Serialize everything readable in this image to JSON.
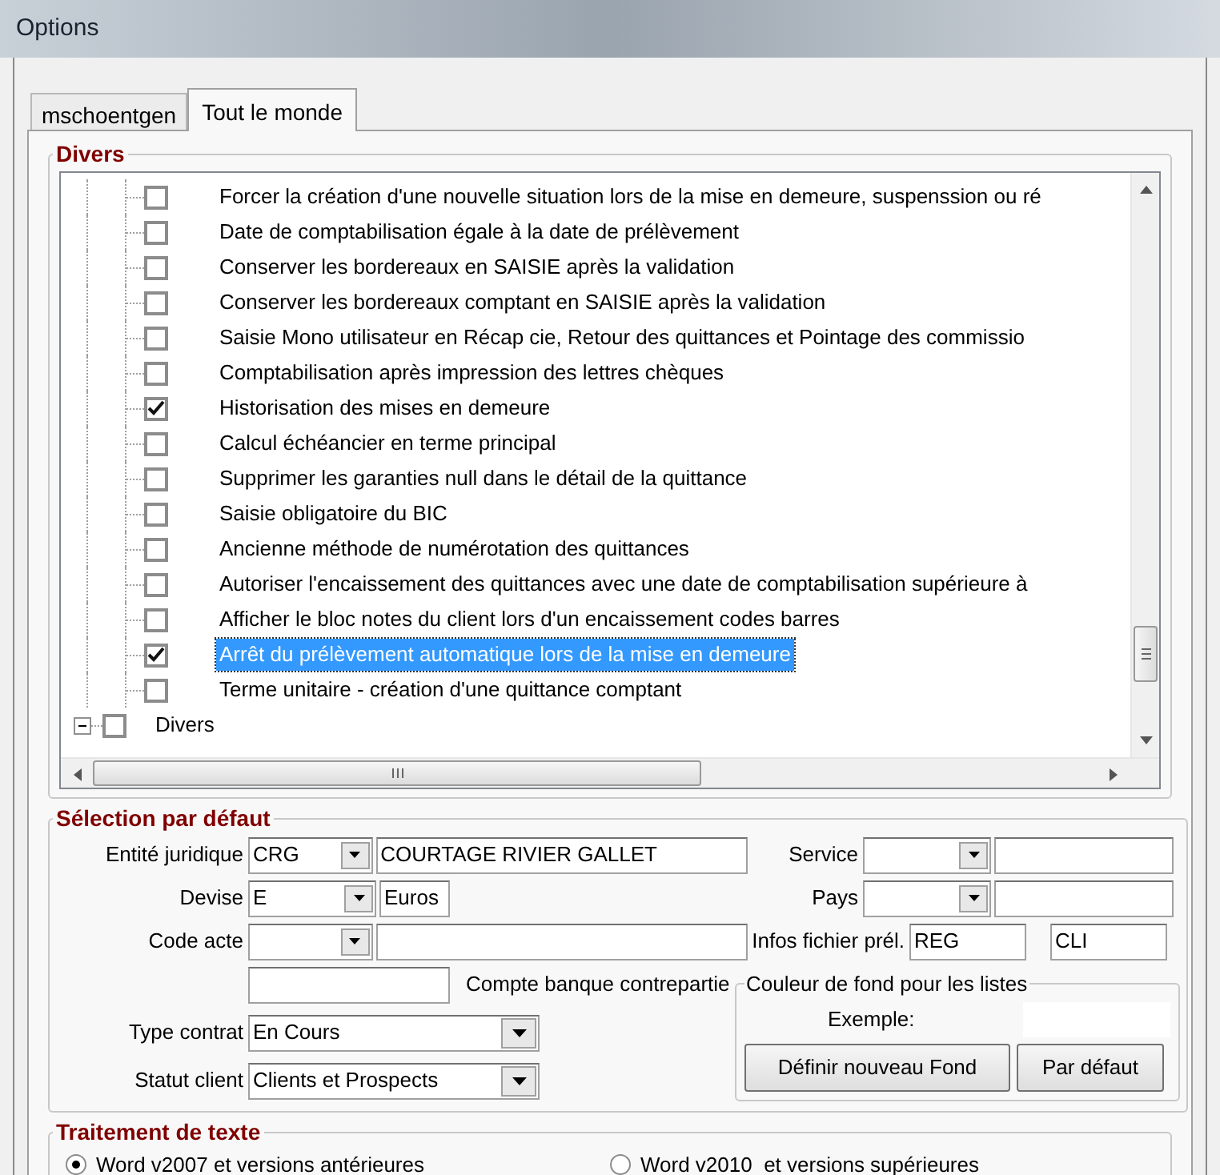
{
  "window": {
    "title": "Options"
  },
  "tabs": [
    {
      "label": "mschoentgen",
      "selected": false
    },
    {
      "label": "Tout le monde",
      "selected": true
    }
  ],
  "divers": {
    "title": "Divers",
    "tree": [
      {
        "children": [
          {
            "label": "Forcer la création d'une nouvelle situation lors de la mise en demeure, suspenssion ou ré",
            "checked": false,
            "selected": false
          },
          {
            "label": "Date de comptabilisation égale à la date de prélèvement",
            "checked": false,
            "selected": false
          },
          {
            "label": "Conserver les bordereaux en SAISIE après la validation",
            "checked": false,
            "selected": false
          },
          {
            "label": "Conserver les bordereaux comptant en SAISIE après la validation",
            "checked": false,
            "selected": false
          },
          {
            "label": "Saisie Mono utilisateur en Récap cie, Retour des quittances et Pointage des commissio",
            "checked": false,
            "selected": false
          },
          {
            "label": "Comptabilisation après impression des lettres chèques",
            "checked": false,
            "selected": false
          },
          {
            "label": "Historisation des mises en demeure",
            "checked": true,
            "selected": false
          },
          {
            "label": "Calcul échéancier en terme principal",
            "checked": false,
            "selected": false
          },
          {
            "label": "Supprimer les garanties null dans le détail de la quittance",
            "checked": false,
            "selected": false
          },
          {
            "label": "Saisie obligatoire du BIC",
            "checked": false,
            "selected": false
          },
          {
            "label": "Ancienne méthode de numérotation des quittances",
            "checked": false,
            "selected": false
          },
          {
            "label": "Autoriser l'encaissement des quittances avec une date de comptabilisation supérieure à",
            "checked": false,
            "selected": false
          },
          {
            "label": "Afficher le bloc notes du client lors d'un encaissement codes barres",
            "checked": false,
            "selected": false
          },
          {
            "label": "Arrêt du prélèvement automatique lors de la mise en demeure",
            "checked": true,
            "selected": true
          },
          {
            "label": "Terme unitaire - création d'une quittance comptant",
            "checked": false,
            "selected": false
          }
        ]
      },
      {
        "label": "Divers",
        "checked": false,
        "expanded": true,
        "selected": false
      }
    ]
  },
  "selection": {
    "title": "Sélection par défaut",
    "left": [
      {
        "kind": "combo_text",
        "label": "Entité juridique",
        "code": "CRG",
        "value": "COURTAGE RIVIER GALLET"
      },
      {
        "kind": "combo_short",
        "label": "Devise",
        "code": "E",
        "value": "Euros"
      },
      {
        "kind": "combo_text",
        "label": "Code acte"
      },
      {
        "kind": "text_after",
        "after": "Compte banque contrepartie"
      },
      {
        "kind": "dropdown",
        "label": "Type contrat",
        "value": "En Cours"
      },
      {
        "kind": "dropdown",
        "label": "Statut client",
        "value": "Clients et Prospects"
      }
    ],
    "right": [
      {
        "kind": "combo_text",
        "label": "Service"
      },
      {
        "kind": "combo_text",
        "label": "Pays"
      },
      {
        "kind": "two_text",
        "label": "Infos fichier prél.",
        "value": "REG",
        "value2": "CLI"
      }
    ],
    "color_group": {
      "title": "Couleur de fond pour les listes",
      "example_label": "Exemple:",
      "buttons": [
        "Définir nouveau Fond",
        "Par défaut"
      ]
    }
  },
  "word_processing": {
    "title": "Traitement de texte",
    "options": [
      {
        "label": "Word v2007 et versions antérieures",
        "selected": true
      },
      {
        "label": "Word v2010  et versions supérieures",
        "selected": false
      }
    ]
  }
}
